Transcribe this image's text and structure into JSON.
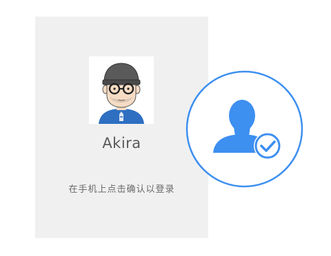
{
  "login_card": {
    "avatar_icon": "user-avatar-cartoon",
    "username": "Akira",
    "confirm_hint": "在手机上点击确认以登录"
  },
  "verify_badge": {
    "icon": "user-verified-icon",
    "accent_color": "#3d8ff0"
  }
}
